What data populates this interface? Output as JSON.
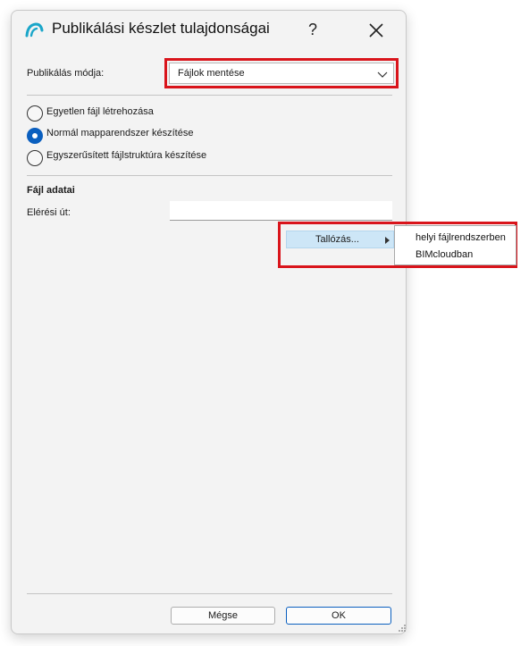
{
  "window": {
    "title": "Publikálási készlet tulajdonságai",
    "help_glyph": "?",
    "close_icon": "close-icon",
    "app_icon": "archicad-logo-icon",
    "accent_color": "#0a5fbf",
    "highlight_color": "#d9141b"
  },
  "publish_mode": {
    "label": "Publikálás módja:",
    "selected": "Fájlok mentése"
  },
  "structure_options": [
    {
      "label": "Egyetlen fájl létrehozása",
      "checked": false
    },
    {
      "label": "Normál mapparendszer készítése",
      "checked": true
    },
    {
      "label": "Egyszerűsített fájlstruktúra készítése",
      "checked": false
    }
  ],
  "file_data": {
    "heading": "Fájl adatai",
    "path_label": "Elérési út:",
    "path_value": ""
  },
  "browse_menu": {
    "label": "Tallózás...",
    "submenu": [
      "helyi fájlrendszerben",
      "BIMcloudban"
    ]
  },
  "footer": {
    "cancel_label": "Mégse",
    "ok_label": "OK"
  }
}
